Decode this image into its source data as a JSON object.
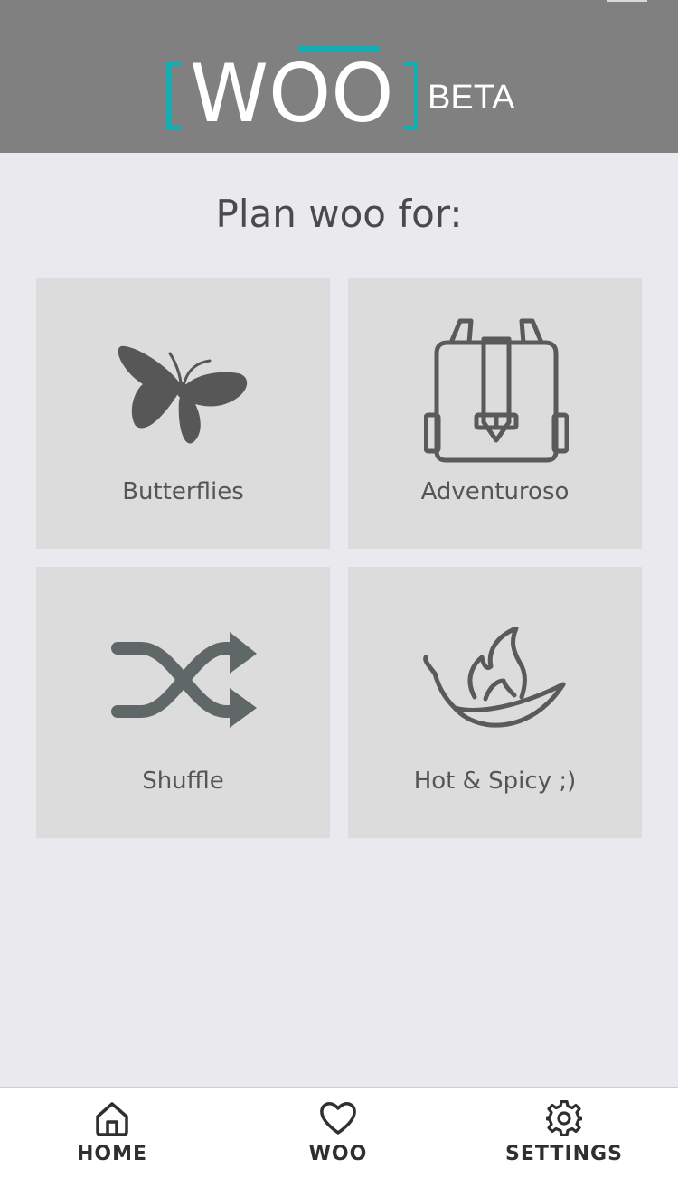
{
  "header": {
    "logo_text": "WOO",
    "beta_label": "BETA",
    "logo_accent_color": "#13adb4",
    "background_color": "#808080"
  },
  "main": {
    "title": "Plan woo for:",
    "tiles": [
      {
        "label": "Butterflies",
        "icon": "butterfly-icon"
      },
      {
        "label": "Adventuroso",
        "icon": "backpack-icon"
      },
      {
        "label": "Shuffle",
        "icon": "shuffle-icon"
      },
      {
        "label": "Hot & Spicy ;)",
        "icon": "chili-flame-icon"
      }
    ]
  },
  "nav": {
    "items": [
      {
        "label": "HOME",
        "icon": "home-icon"
      },
      {
        "label": "WOO",
        "icon": "heart-icon"
      },
      {
        "label": "SETTINGS",
        "icon": "gear-icon"
      }
    ]
  }
}
